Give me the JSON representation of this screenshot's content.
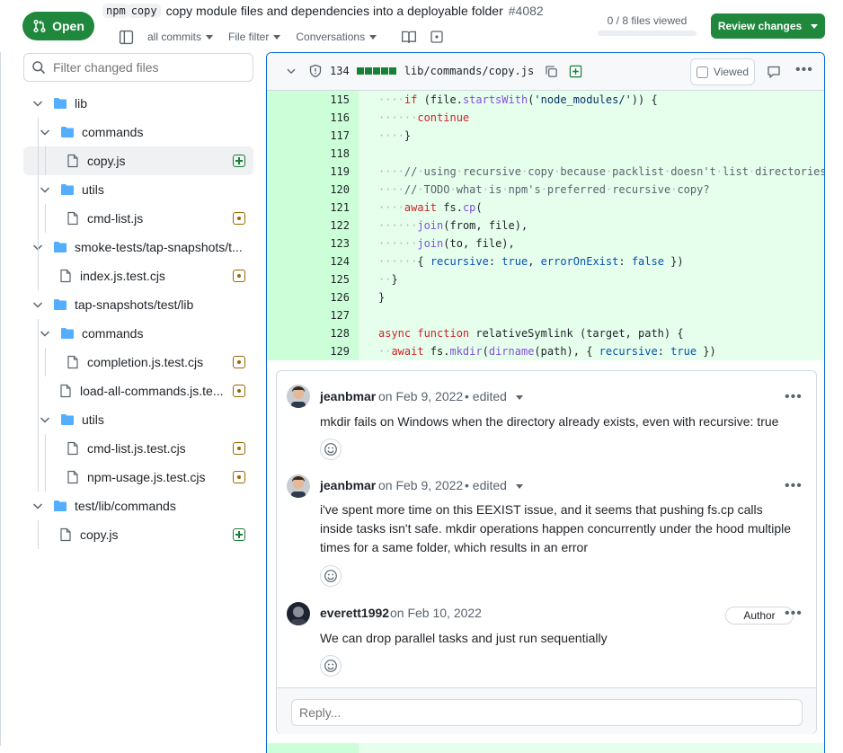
{
  "header": {
    "status_label": "Open",
    "title_pills": [
      "npm",
      "copy"
    ],
    "title": "copy module files and dependencies into a deployable folder",
    "pr_number": "#4082",
    "toolbar": {
      "commits_label": "all commits",
      "file_filter_label": "File filter",
      "conversations_label": "Conversations"
    },
    "files_viewed": "0 / 8 files viewed",
    "files_viewed_fraction": 0,
    "review_button": "Review changes"
  },
  "sidebar": {
    "filter_placeholder": "Filter changed files",
    "tree": [
      {
        "label": "lib",
        "kind": "folder"
      },
      {
        "label": "commands",
        "kind": "folder"
      },
      {
        "label": "copy.js",
        "kind": "file",
        "status": "added"
      },
      {
        "label": "utils",
        "kind": "folder"
      },
      {
        "label": "cmd-list.js",
        "kind": "file",
        "status": "modified"
      },
      {
        "label": "smoke-tests/tap-snapshots/t...",
        "kind": "folder"
      },
      {
        "label": "index.js.test.cjs",
        "kind": "file",
        "status": "modified"
      },
      {
        "label": "tap-snapshots/test/lib",
        "kind": "folder"
      },
      {
        "label": "commands",
        "kind": "folder"
      },
      {
        "label": "completion.js.test.cjs",
        "kind": "file",
        "status": "modified"
      },
      {
        "label": "load-all-commands.js.te...",
        "kind": "file",
        "status": "modified"
      },
      {
        "label": "utils",
        "kind": "folder"
      },
      {
        "label": "cmd-list.js.test.cjs",
        "kind": "file",
        "status": "modified"
      },
      {
        "label": "npm-usage.js.test.cjs",
        "kind": "file",
        "status": "modified"
      },
      {
        "label": "test/lib/commands",
        "kind": "folder"
      },
      {
        "label": "copy.js",
        "kind": "file",
        "status": "added"
      }
    ]
  },
  "diff": {
    "line_count": "134",
    "file_path": "lib/commands/copy.js",
    "viewed_label": "Viewed",
    "lines": [
      {
        "n": "115",
        "text": "····if (file.startsWith('node_modules/')) {"
      },
      {
        "n": "116",
        "text": "······continue"
      },
      {
        "n": "117",
        "text": "····}"
      },
      {
        "n": "118",
        "text": ""
      },
      {
        "n": "119",
        "text": "····// using recursive copy because packlist doesn't list directories."
      },
      {
        "n": "120",
        "text": "····// TODO what is npm's preferred recursive copy?"
      },
      {
        "n": "121",
        "text": "····await fs.cp("
      },
      {
        "n": "122",
        "text": "······join(from, file),"
      },
      {
        "n": "123",
        "text": "······join(to, file),"
      },
      {
        "n": "124",
        "text": "······{ recursive: true, errorOnExist: false })"
      },
      {
        "n": "125",
        "text": "··}"
      },
      {
        "n": "126",
        "text": "}"
      },
      {
        "n": "127",
        "text": ""
      },
      {
        "n": "128",
        "text": "async function relativeSymlink (target, path) {"
      },
      {
        "n": "129",
        "text": "··await fs.mkdir(dirname(path), { recursive: true })"
      }
    ]
  },
  "comments": [
    {
      "author": "jeanbmar",
      "date": "on Feb 9, 2022",
      "edited": "• edited",
      "body": "mkdir fails on Windows when the directory already exists, even with recursive: true"
    },
    {
      "author": "jeanbmar",
      "date": "on Feb 9, 2022",
      "edited": "• edited",
      "body": "i've spent more time on this EEXIST issue, and it seems that pushing fs.cp calls inside tasks isn't safe. mkdir operations happen concurrently under the hood multiple times for a same folder, which results in an error"
    },
    {
      "author": "everett1992",
      "date": "on Feb 10, 2022",
      "badge": "Author",
      "body": "We can drop parallel tasks and just run sequentially"
    }
  ],
  "reply_placeholder": "Reply...",
  "colors": {
    "accent_green": "#1f883d",
    "added_bg": "#e6ffec",
    "added_gutter": "#ccffd8",
    "focus_blue": "#0969da"
  }
}
